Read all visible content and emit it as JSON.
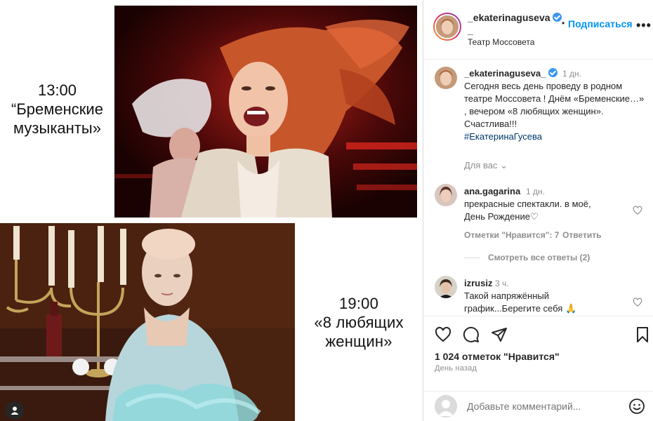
{
  "collage": {
    "top_left_text": "13:00\n“Бременские\nмузыканты»",
    "bottom_right_text": "19:00\n«8  любящих\nженщин»"
  },
  "header": {
    "username": "_ekaterinaguseva",
    "username_suffix": "_",
    "dot": "•",
    "follow_label": "Подписаться",
    "more": "•••",
    "location": "Театр Моссовета"
  },
  "caption": {
    "username": "_ekaterinaguseva_",
    "time": "1 дн.",
    "text": "Сегодня весь день проведу в родном театре Моссовета ! Днём «Бременские…» , вечером «8 любящих женщин». Счастлива!!!",
    "hashtag": "#ЕкатеринаГусева",
    "translate_label": "Для вас ⌄"
  },
  "comments": [
    {
      "username": "ana.gagarina",
      "time": "1 дн.",
      "text": "прекрасные спектакли. в моё, День Рождение♡",
      "likes_label": "Отметки \"Нравится\": 7",
      "reply_label": "Ответить"
    },
    {
      "username": "izrusiz",
      "time": "3 ч.",
      "text": "Такой напряжённый график...Берегите себя 🙏"
    }
  ],
  "view_replies": "Смотреть все ответы (2)",
  "likes": "1 024 отметок \"Нравится\"",
  "date": "День назад",
  "add_comment": {
    "placeholder": "Добавьте комментарий..."
  },
  "colors": {
    "follow": "#0095f6",
    "verified": "#3897f0",
    "muted": "#8e8e8e",
    "hashtag": "#00376b"
  }
}
